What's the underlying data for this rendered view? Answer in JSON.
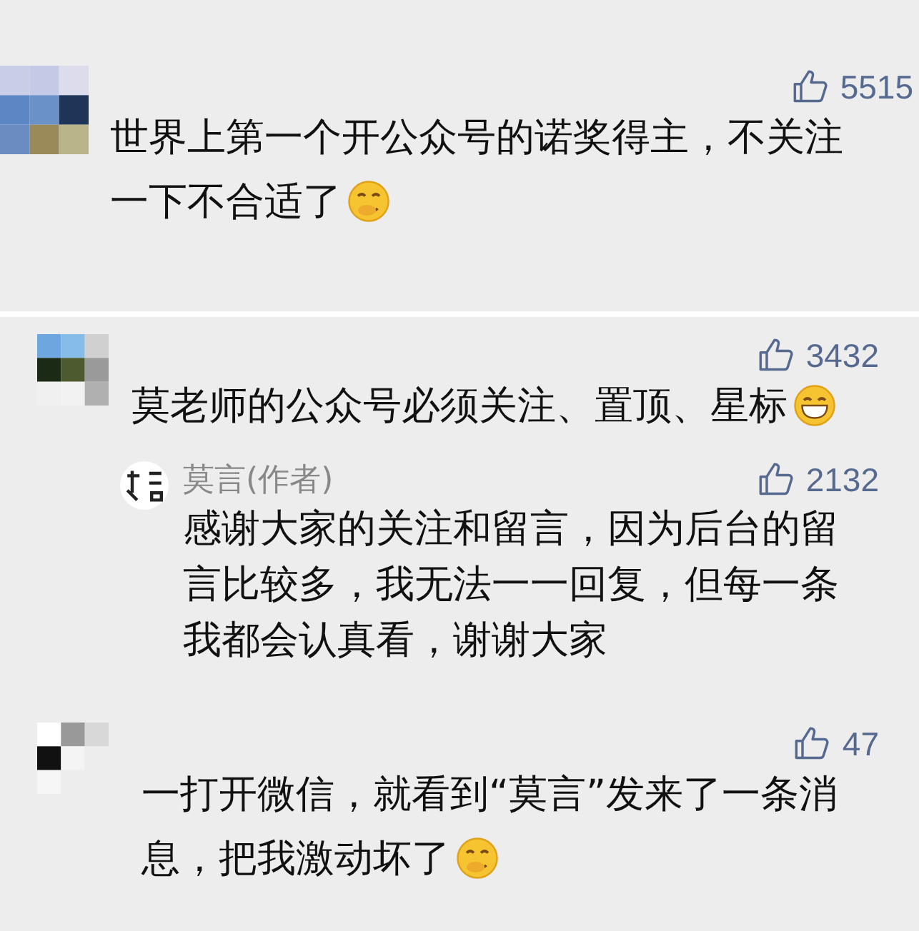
{
  "panels": [
    {
      "comments": [
        {
          "likes": "5515",
          "lines": [
            "世界上第一个开公众号的诺奖得主，不关注",
            "一下不合适了"
          ]
        }
      ]
    },
    {
      "comments": [
        {
          "likes": "3432",
          "lines": [
            "莫老师的公众号必须关注、置顶、星标"
          ],
          "replies": [
            {
              "author": "莫言(作者)",
              "likes": "2132",
              "lines": [
                "感谢大家的关注和留言，因为后台的留",
                "言比较多，我无法一一回复，但每一条",
                "我都会认真看，谢谢大家"
              ]
            }
          ]
        },
        {
          "likes": "47",
          "lines": [
            "一打开微信，就看到“莫言”发来了一条消",
            "息，把我激动坏了"
          ]
        }
      ]
    }
  ]
}
